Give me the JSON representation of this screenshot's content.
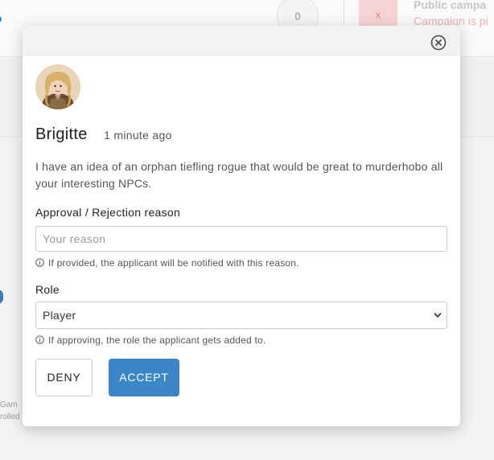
{
  "background": {
    "circle_button_text": "0",
    "red_tile_text": "x",
    "line1": "Public campa",
    "line2": "Campaign is pi",
    "left_text_1": "Gam",
    "left_text_2": "rolled"
  },
  "modal": {
    "applicant": {
      "name": "Brigitte",
      "timestamp": "1 minute ago",
      "message": "I have an idea of an orphan tiefling rogue that would be great to murderhobo all your interesting NPCs."
    },
    "reason": {
      "label": "Approval / Rejection reason",
      "placeholder": "Your reason",
      "value": "",
      "hint": "If provided, the applicant will be notified with this reason."
    },
    "role": {
      "label": "Role",
      "selected": "Player",
      "hint": "If approving, the role the applicant gets added to."
    },
    "buttons": {
      "deny": "DENY",
      "accept": "ACCEPT"
    },
    "icons": {
      "close": "close-circle-icon",
      "info": "info-circle-icon",
      "chevron": "chevron-down-icon",
      "avatar": "avatar-portrait"
    }
  },
  "colors": {
    "accent": "#3a86c6",
    "text": "#1e1e1e",
    "muted": "#555555",
    "border": "#cccccc"
  }
}
